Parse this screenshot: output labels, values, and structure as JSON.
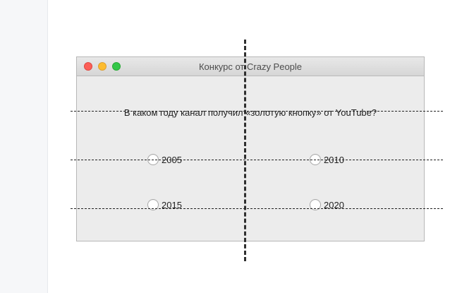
{
  "window": {
    "title": "Конкурс от Crazy People"
  },
  "question": {
    "text": "В каком году канал получил «золотую кнопку» от YouTube?"
  },
  "options": [
    {
      "label": "2005",
      "selected": false
    },
    {
      "label": "2010",
      "selected": false
    },
    {
      "label": "2015",
      "selected": false
    },
    {
      "label": "2020",
      "selected": false
    }
  ],
  "colors": {
    "close": "#fc5f57",
    "minimize": "#fdbc2e",
    "zoom": "#33c748",
    "window_bg": "#ececec"
  }
}
